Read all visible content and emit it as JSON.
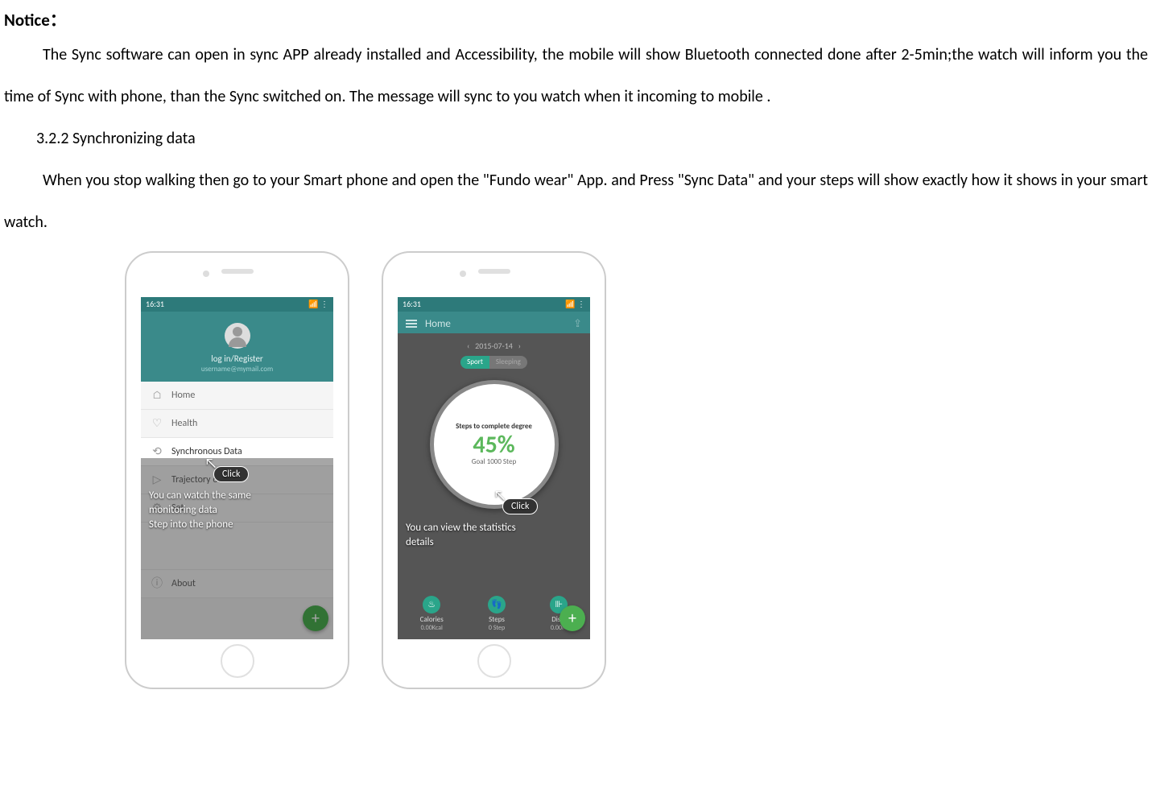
{
  "doc": {
    "notice_label": "Notice：",
    "notice_body": "The Sync software can open in sync APP already installed and Accessibility, the mobile will show Bluetooth connected done after 2-5min;the watch will inform you the time of Sync with phone, than the Sync switched on. The message will sync to you watch when it incoming to mobile .",
    "section_heading": "3.2.2 Synchronizing data",
    "section_body": "When you stop walking then go to your Smart phone and open the \"Fundo wear\" App. and Press \"Sync Data\" and your steps will show exactly how it shows in your smart watch."
  },
  "phone1": {
    "status_time": "16:31",
    "login_label": "log in/Register",
    "email": "username@mymail.com",
    "menu": {
      "home": "Home",
      "health": "Health",
      "sync": "Synchronous Data",
      "trajectory": "Trajectory of M",
      "set": "Set",
      "about": "About"
    },
    "click_label": "Click",
    "overlay_line1": "You can watch the same",
    "overlay_line2": "monitoring data",
    "overlay_line3": "Step into the phone"
  },
  "phone2": {
    "status_time": "16:31",
    "header_title": "Home",
    "date": "2015-07-14",
    "tab_sport": "Sport",
    "tab_sleeping": "Sleeping",
    "circle_top": "Steps to complete degree",
    "percent": "45%",
    "goal": "Goal 1000 Step",
    "click_label": "Click",
    "overlay_line1": "You can view the statistics",
    "overlay_line2": "details",
    "stats": {
      "calories_label": "Calories",
      "calories_value": "0.00Kcal",
      "steps_label": "Steps",
      "steps_value": "0 Step",
      "dist_label": "Dista",
      "dist_value": "0.00M"
    }
  }
}
